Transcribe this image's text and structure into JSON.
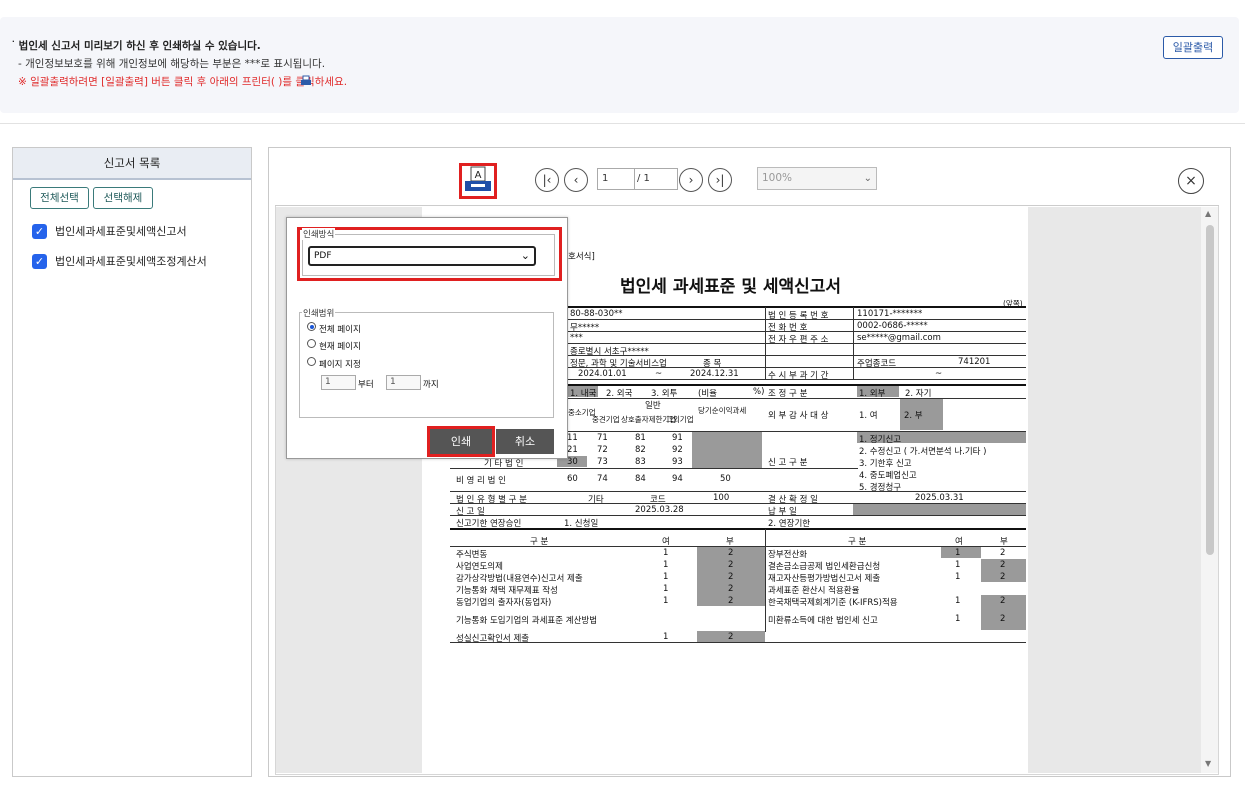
{
  "info": {
    "line1": "법인세 신고서 미리보기 하신 후 인쇄하실 수 있습니다.",
    "line2": "- 개인정보보호를 위해 개인정보에 해당하는 부분은 ***로 표시됩니다.",
    "line3": "※ 일괄출력하려면 [일괄출력] 버튼 클릭 후 아래의 프린터(  )를 클릭하세요.",
    "bulk_print_label": "일괄출력"
  },
  "sidebar": {
    "title": "신고서 목록",
    "select_all": "전체선택",
    "deselect": "선택해제",
    "items": [
      {
        "label": "법인세과세표준및세액신고서",
        "checked": true
      },
      {
        "label": "법인세과세표준및세액조정계산서",
        "checked": true
      }
    ]
  },
  "toolbar": {
    "page_current": "1",
    "page_total": "/ 1",
    "zoom": "100%"
  },
  "dialog": {
    "method_legend": "인쇄방식",
    "method_value": "PDF",
    "range_legend": "인쇄범위",
    "options": [
      "전체 페이지",
      "현재 페이지",
      "페이지 지정"
    ],
    "selected_option": 0,
    "from_value": "1",
    "from_label": "부터",
    "to_value": "1",
    "to_label": "까지",
    "print_label": "인쇄",
    "cancel_label": "취소"
  },
  "document": {
    "form_tag": "호서식]",
    "title": "법인세 과세표준 및 세액신고서",
    "page_tag": "(앞쪽)",
    "biz_no": "80-88-030**",
    "rep": "무*****",
    "addr_mask": "***",
    "addr": "종로별시 서초구*****",
    "industry": "정문, 과학 및 기술서비스업",
    "period_from": "2024.01.01",
    "period_tilde": "~",
    "period_to": "2024.12.31",
    "corp_reg_label": "법 인 등 록 번 호",
    "corp_reg": "110171-*******",
    "phone_label": "전 화 번 호",
    "phone": "0002-0686-*****",
    "email_label": "전 자 우 편 주 소",
    "email": "se*****@gmail.com",
    "main_label": "종 목",
    "main_code_label": "주업종코드",
    "main_code": "741201",
    "period_label": "수 시 부 과 기 간",
    "period_tilde2": "~",
    "adj_label": "조 정 구 분",
    "adj_ext": "1. 외부",
    "adj_self": "2. 자기",
    "audit_label": "외 부 감 사 대 상",
    "audit_yes": "1. 여",
    "audit_no": "2. 부",
    "type_label": "신 고 구 분",
    "type_list": [
      "1. 정기신고",
      "2. 수정신고 ( 가.서면분석 나.기타 )",
      "3. 기한후 신고",
      "4. 중도폐업신고",
      "5. 경정청구"
    ],
    "corp_kind": [
      "1. 내국",
      "2. 외국",
      "3. 외투"
    ],
    "ratio": "(비율",
    "ratio_pct": "%)",
    "general": "일반",
    "col_heads": [
      "중소기업",
      "중견기업",
      "상호출자제한기업",
      "그외기업",
      "당기순이익과세"
    ],
    "rows": [
      [
        "11",
        "71",
        "81",
        "91"
      ],
      [
        "21",
        "72",
        "82",
        "92"
      ],
      [
        "30",
        "73",
        "83",
        "93"
      ],
      [
        "60",
        "74",
        "84",
        "94",
        "50"
      ]
    ],
    "row_label3": "기 타 법 인",
    "row_label4": "비 영 리 법 인",
    "owner_label": "법 인 유 형 별 구 분",
    "owner_value": "기타",
    "code_label": "코드",
    "code_value": "100",
    "settle_label": "결 산 확 정 일",
    "settle_value": "2025.03.31",
    "filing_label": "신 고 일",
    "filing_value": "2025.03.28",
    "pay_label": "납 부 일",
    "ext_label": "신고기한 연장승인",
    "ext_1": "1. 신청일",
    "ext_2": "2. 연장기한",
    "table_hd": [
      "구 분",
      "여",
      "부",
      "구 분",
      "여",
      "부"
    ],
    "left_items": [
      [
        "주식변동",
        "1",
        "2"
      ],
      [
        "사업연도의제",
        "1",
        "2"
      ],
      [
        "감가상각방법(내용연수)신고서 제출",
        "1",
        "2"
      ],
      [
        "기능통화 채택 재무제표 작성",
        "1",
        "2"
      ],
      [
        "동업기업의 출자자(동업자)",
        "1",
        "2"
      ],
      [
        "기능통화 도입기업의 과세표준 계산방법",
        "",
        ""
      ],
      [
        "성실신고확인서 제출",
        "1",
        "2"
      ]
    ],
    "right_items": [
      [
        "장부전산화",
        "1",
        "2"
      ],
      [
        "결손금소급공제 법인세환급신청",
        "1",
        "2"
      ],
      [
        "재고자산등평가방법신고서 제출",
        "1",
        "2"
      ],
      [
        "과세표준 환산시 적용환율",
        "",
        ""
      ],
      [
        "한국채택국제회계기준 (K-IFRS)적용",
        "1",
        "2"
      ],
      [
        "미환류소득에 대한 법인세 신고",
        "1",
        "2"
      ]
    ]
  }
}
